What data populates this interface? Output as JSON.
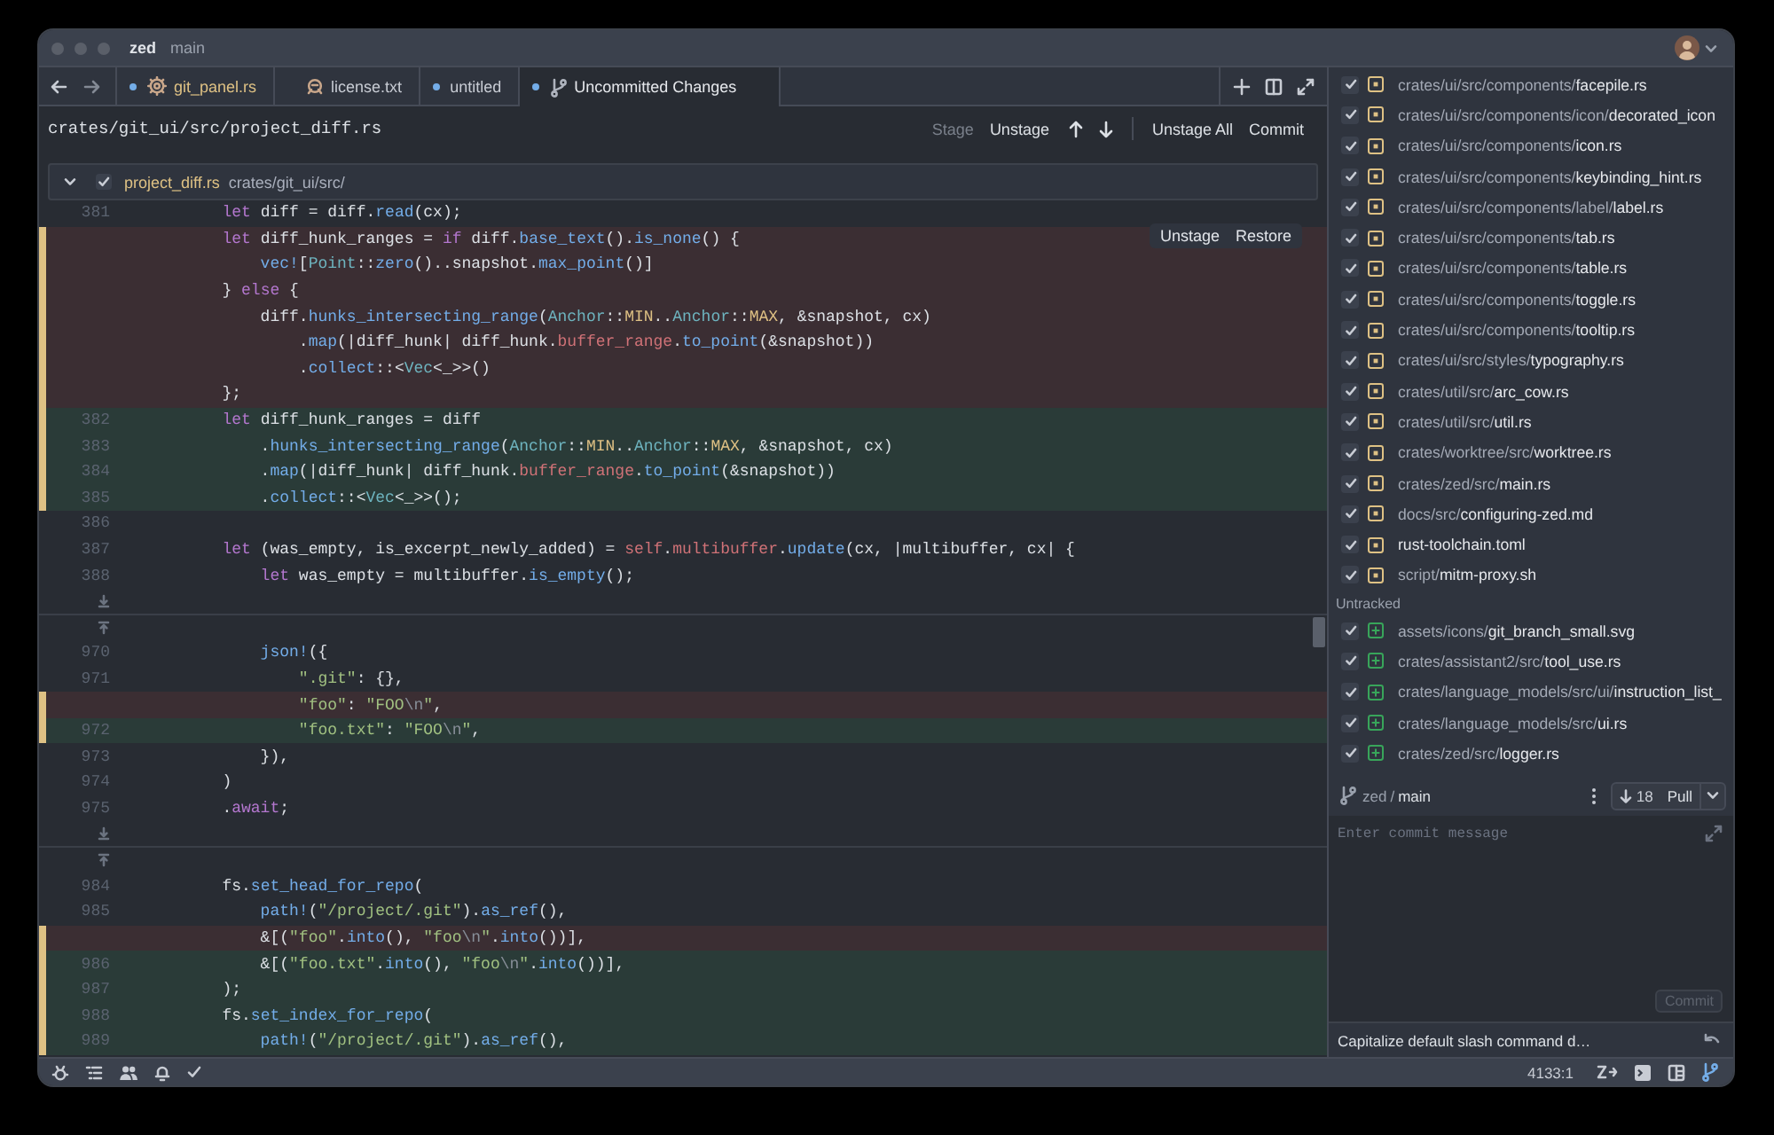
{
  "title_bar": {
    "project": "zed",
    "branch": "main"
  },
  "tabs": [
    {
      "label": "git_panel.rs",
      "selected": false,
      "unsaved": true,
      "git_modified": true,
      "kind": "rust"
    },
    {
      "label": "license.txt",
      "selected": false,
      "unsaved": false,
      "git_modified": false,
      "kind": "license"
    },
    {
      "label": "untitled",
      "selected": false,
      "unsaved": true,
      "git_modified": false,
      "kind": "plain"
    },
    {
      "label": "Uncommitted Changes",
      "selected": true,
      "unsaved": true,
      "git_modified": false,
      "kind": "diff"
    }
  ],
  "toolbar": {
    "path": "crates/git_ui/src/project_diff.rs",
    "stage_buttons": [
      {
        "label": "Stage",
        "disabled": true
      },
      {
        "label": "Unstage",
        "disabled": false
      }
    ],
    "commit_buttons": [
      {
        "label": "Unstage All",
        "disabled": false
      },
      {
        "label": "Commit",
        "disabled": false
      }
    ]
  },
  "excerpt": {
    "expanded": true,
    "checked": true,
    "file": "project_diff.rs",
    "dir": "crates/git_ui/src/"
  },
  "code_rows": [
    {
      "kind": "context",
      "number": "381",
      "code": [
        {
          "kind": "kw",
          "text": "        let"
        },
        {
          "kind": "p",
          "text": " diff = diff."
        },
        {
          "kind": "fn",
          "text": "read"
        },
        {
          "kind": "p",
          "text": "(cx);"
        }
      ]
    },
    {
      "kind": "removed",
      "hunk_controls": [
        "Unstage",
        "Restore"
      ],
      "code": [
        {
          "kind": "kw",
          "text": "        let"
        },
        {
          "kind": "p",
          "text": " diff_hunk_ranges = "
        },
        {
          "kind": "kw",
          "text": "if"
        },
        {
          "kind": "p",
          "text": " diff."
        },
        {
          "kind": "fn",
          "text": "base_text"
        },
        {
          "kind": "p",
          "text": "()."
        },
        {
          "kind": "fn",
          "text": "is_none"
        },
        {
          "kind": "p",
          "text": "() {"
        }
      ]
    },
    {
      "kind": "removed",
      "code": [
        {
          "kind": "fn",
          "text": "            vec!"
        },
        {
          "kind": "p",
          "text": "["
        },
        {
          "kind": "ty",
          "text": "Point"
        },
        {
          "kind": "p",
          "text": "::"
        },
        {
          "kind": "fn",
          "text": "zero"
        },
        {
          "kind": "p",
          "text": "()..snapshot."
        },
        {
          "kind": "fn",
          "text": "max_point"
        },
        {
          "kind": "p",
          "text": "()]"
        }
      ]
    },
    {
      "kind": "removed",
      "code": [
        {
          "kind": "p",
          "text": "        } "
        },
        {
          "kind": "kw",
          "text": "else"
        },
        {
          "kind": "p",
          "text": " {"
        }
      ]
    },
    {
      "kind": "removed",
      "code": [
        {
          "kind": "p",
          "text": "            diff."
        },
        {
          "kind": "fn",
          "text": "hunks_intersecting_range"
        },
        {
          "kind": "p",
          "text": "("
        },
        {
          "kind": "ty",
          "text": "Anchor"
        },
        {
          "kind": "p",
          "text": "::"
        },
        {
          "kind": "const",
          "text": "MIN"
        },
        {
          "kind": "p",
          "text": ".."
        },
        {
          "kind": "ty",
          "text": "Anchor"
        },
        {
          "kind": "p",
          "text": "::"
        },
        {
          "kind": "const",
          "text": "MAX"
        },
        {
          "kind": "p",
          "text": ", &snapshot, cx)"
        }
      ]
    },
    {
      "kind": "removed",
      "code": [
        {
          "kind": "p",
          "text": "                ."
        },
        {
          "kind": "fn",
          "text": "map"
        },
        {
          "kind": "p",
          "text": "(|diff_hunk| diff_hunk."
        },
        {
          "kind": "field",
          "text": "buffer_range"
        },
        {
          "kind": "p",
          "text": "."
        },
        {
          "kind": "fn",
          "text": "to_point"
        },
        {
          "kind": "p",
          "text": "(&snapshot))"
        }
      ]
    },
    {
      "kind": "removed",
      "code": [
        {
          "kind": "p",
          "text": "                ."
        },
        {
          "kind": "fn",
          "text": "collect"
        },
        {
          "kind": "p",
          "text": "::<"
        },
        {
          "kind": "ty",
          "text": "Vec"
        },
        {
          "kind": "p",
          "text": "<_>>()"
        }
      ]
    },
    {
      "kind": "removed",
      "code": [
        {
          "kind": "p",
          "text": "        };"
        }
      ]
    },
    {
      "kind": "added",
      "number": "382",
      "code": [
        {
          "kind": "kw",
          "text": "        let"
        },
        {
          "kind": "p",
          "text": " diff_hunk_ranges = diff"
        }
      ]
    },
    {
      "kind": "added",
      "number": "383",
      "code": [
        {
          "kind": "p",
          "text": "            ."
        },
        {
          "kind": "fn",
          "text": "hunks_intersecting_range"
        },
        {
          "kind": "p",
          "text": "("
        },
        {
          "kind": "ty",
          "text": "Anchor"
        },
        {
          "kind": "p",
          "text": "::"
        },
        {
          "kind": "const",
          "text": "MIN"
        },
        {
          "kind": "p",
          "text": ".."
        },
        {
          "kind": "ty",
          "text": "Anchor"
        },
        {
          "kind": "p",
          "text": "::"
        },
        {
          "kind": "const",
          "text": "MAX"
        },
        {
          "kind": "p",
          "text": ", &snapshot, cx)"
        }
      ]
    },
    {
      "kind": "added",
      "number": "384",
      "code": [
        {
          "kind": "p",
          "text": "            ."
        },
        {
          "kind": "fn",
          "text": "map"
        },
        {
          "kind": "p",
          "text": "(|diff_hunk| diff_hunk."
        },
        {
          "kind": "field",
          "text": "buffer_range"
        },
        {
          "kind": "p",
          "text": "."
        },
        {
          "kind": "fn",
          "text": "to_point"
        },
        {
          "kind": "p",
          "text": "(&snapshot))"
        }
      ]
    },
    {
      "kind": "added",
      "number": "385",
      "code": [
        {
          "kind": "p",
          "text": "            ."
        },
        {
          "kind": "fn",
          "text": "collect"
        },
        {
          "kind": "p",
          "text": "::<"
        },
        {
          "kind": "ty",
          "text": "Vec"
        },
        {
          "kind": "p",
          "text": "<_>>();"
        }
      ]
    },
    {
      "kind": "context",
      "number": "386"
    },
    {
      "kind": "context",
      "number": "387",
      "code": [
        {
          "kind": "kw",
          "text": "        let"
        },
        {
          "kind": "p",
          "text": " (was_empty, is_excerpt_newly_added) = "
        },
        {
          "kind": "field",
          "text": "self"
        },
        {
          "kind": "p",
          "text": "."
        },
        {
          "kind": "field",
          "text": "multibuffer"
        },
        {
          "kind": "p",
          "text": "."
        },
        {
          "kind": "fn",
          "text": "update"
        },
        {
          "kind": "p",
          "text": "(cx, |multibuffer, cx| {"
        }
      ]
    },
    {
      "kind": "context",
      "number": "388",
      "code": [
        {
          "kind": "kw",
          "text": "            let"
        },
        {
          "kind": "p",
          "text": " was_empty = multibuffer."
        },
        {
          "kind": "fn",
          "text": "is_empty"
        },
        {
          "kind": "p",
          "text": "();"
        }
      ]
    },
    {
      "kind": "expand_down"
    },
    {
      "kind": "expand_up"
    },
    {
      "kind": "context",
      "number": "970",
      "code": [
        {
          "kind": "fn",
          "text": "            json!"
        },
        {
          "kind": "p",
          "text": "({"
        }
      ]
    },
    {
      "kind": "context",
      "number": "971",
      "code": [
        {
          "kind": "str",
          "text": "                \".git\""
        },
        {
          "kind": "p",
          "text": ": {},"
        }
      ]
    },
    {
      "kind": "removed",
      "code": [
        {
          "kind": "str",
          "text": "                \"foo\""
        },
        {
          "kind": "p",
          "text": ": "
        },
        {
          "kind": "str",
          "text": "\"FOO"
        },
        {
          "kind": "esc",
          "text": "\\n"
        },
        {
          "kind": "str",
          "text": "\""
        },
        {
          "kind": "p",
          "text": ","
        }
      ]
    },
    {
      "kind": "added",
      "number": "972",
      "code": [
        {
          "kind": "str",
          "text": "                \"foo.txt\""
        },
        {
          "kind": "p",
          "text": ": "
        },
        {
          "kind": "str",
          "text": "\"FOO"
        },
        {
          "kind": "esc",
          "text": "\\n"
        },
        {
          "kind": "str",
          "text": "\""
        },
        {
          "kind": "p",
          "text": ","
        }
      ]
    },
    {
      "kind": "context",
      "number": "973",
      "code": [
        {
          "kind": "p",
          "text": "            }),"
        }
      ]
    },
    {
      "kind": "context",
      "number": "974",
      "code": [
        {
          "kind": "p",
          "text": "        )"
        }
      ]
    },
    {
      "kind": "context",
      "number": "975",
      "code": [
        {
          "kind": "p",
          "text": "        ."
        },
        {
          "kind": "kw",
          "text": "await"
        },
        {
          "kind": "p",
          "text": ";"
        }
      ]
    },
    {
      "kind": "expand_down"
    },
    {
      "kind": "expand_up"
    },
    {
      "kind": "context",
      "number": "984",
      "code": [
        {
          "kind": "p",
          "text": "        fs."
        },
        {
          "kind": "fn",
          "text": "set_head_for_repo"
        },
        {
          "kind": "p",
          "text": "("
        }
      ]
    },
    {
      "kind": "context",
      "number": "985",
      "code": [
        {
          "kind": "fn",
          "text": "            path!"
        },
        {
          "kind": "p",
          "text": "("
        },
        {
          "kind": "str",
          "text": "\"/project/.git\""
        },
        {
          "kind": "p",
          "text": ")."
        },
        {
          "kind": "fn",
          "text": "as_ref"
        },
        {
          "kind": "p",
          "text": "(),"
        }
      ]
    },
    {
      "kind": "removed",
      "code": [
        {
          "kind": "p",
          "text": "            &[("
        },
        {
          "kind": "str",
          "text": "\"foo\""
        },
        {
          "kind": "p",
          "text": "."
        },
        {
          "kind": "fn",
          "text": "into"
        },
        {
          "kind": "p",
          "text": "(), "
        },
        {
          "kind": "str",
          "text": "\"foo"
        },
        {
          "kind": "esc",
          "text": "\\n"
        },
        {
          "kind": "str",
          "text": "\""
        },
        {
          "kind": "p",
          "text": "."
        },
        {
          "kind": "fn",
          "text": "into"
        },
        {
          "kind": "p",
          "text": "())],"
        }
      ]
    },
    {
      "kind": "added",
      "number": "986",
      "code": [
        {
          "kind": "p",
          "text": "            &[("
        },
        {
          "kind": "str",
          "text": "\"foo.txt\""
        },
        {
          "kind": "p",
          "text": "."
        },
        {
          "kind": "fn",
          "text": "into"
        },
        {
          "kind": "p",
          "text": "(), "
        },
        {
          "kind": "str",
          "text": "\"foo"
        },
        {
          "kind": "esc",
          "text": "\\n"
        },
        {
          "kind": "str",
          "text": "\""
        },
        {
          "kind": "p",
          "text": "."
        },
        {
          "kind": "fn",
          "text": "into"
        },
        {
          "kind": "p",
          "text": "())],"
        }
      ]
    },
    {
      "kind": "added",
      "number": "987",
      "code": [
        {
          "kind": "p",
          "text": "        );"
        }
      ]
    },
    {
      "kind": "added",
      "number": "988",
      "code": [
        {
          "kind": "p",
          "text": "        fs."
        },
        {
          "kind": "fn",
          "text": "set_index_for_repo"
        },
        {
          "kind": "p",
          "text": "("
        }
      ]
    },
    {
      "kind": "added",
      "number": "989",
      "code": [
        {
          "kind": "fn",
          "text": "            path!"
        },
        {
          "kind": "p",
          "text": "("
        },
        {
          "kind": "str",
          "text": "\"/project/.git\""
        },
        {
          "kind": "p",
          "text": ")."
        },
        {
          "kind": "fn",
          "text": "as_ref"
        },
        {
          "kind": "p",
          "text": "(),"
        }
      ]
    }
  ],
  "git_panel": {
    "changes": [
      {
        "dir": "crates/ui/src/components/",
        "name": "facepile.rs",
        "checked": true,
        "kind": "modified"
      },
      {
        "dir": "crates/ui/src/components/icon/",
        "name": "decorated_icon",
        "checked": true,
        "kind": "modified"
      },
      {
        "dir": "crates/ui/src/components/",
        "name": "icon.rs",
        "checked": true,
        "kind": "modified"
      },
      {
        "dir": "crates/ui/src/components/",
        "name": "keybinding_hint.rs",
        "checked": true,
        "kind": "modified"
      },
      {
        "dir": "crates/ui/src/components/label/",
        "name": "label.rs",
        "checked": true,
        "kind": "modified"
      },
      {
        "dir": "crates/ui/src/components/",
        "name": "tab.rs",
        "checked": true,
        "kind": "modified"
      },
      {
        "dir": "crates/ui/src/components/",
        "name": "table.rs",
        "checked": true,
        "kind": "modified"
      },
      {
        "dir": "crates/ui/src/components/",
        "name": "toggle.rs",
        "checked": true,
        "kind": "modified"
      },
      {
        "dir": "crates/ui/src/components/",
        "name": "tooltip.rs",
        "checked": true,
        "kind": "modified"
      },
      {
        "dir": "crates/ui/src/styles/",
        "name": "typography.rs",
        "checked": true,
        "kind": "modified"
      },
      {
        "dir": "crates/util/src/",
        "name": "arc_cow.rs",
        "checked": true,
        "kind": "modified"
      },
      {
        "dir": "crates/util/src/",
        "name": "util.rs",
        "checked": true,
        "kind": "modified"
      },
      {
        "dir": "crates/worktree/src/",
        "name": "worktree.rs",
        "checked": true,
        "kind": "modified"
      },
      {
        "dir": "crates/zed/src/",
        "name": "main.rs",
        "checked": true,
        "kind": "modified"
      },
      {
        "dir": "docs/src/",
        "name": "configuring-zed.md",
        "checked": true,
        "kind": "modified"
      },
      {
        "name": "rust-toolchain.toml",
        "checked": true,
        "kind": "modified"
      },
      {
        "dir": "script/",
        "name": "mitm-proxy.sh",
        "checked": true,
        "kind": "modified"
      }
    ],
    "untracked_header": "Untracked",
    "untracked": [
      {
        "dir": "assets/icons/",
        "name": "git_branch_small.svg",
        "checked": true,
        "kind": "added"
      },
      {
        "dir": "crates/assistant2/src/",
        "name": "tool_use.rs",
        "checked": true,
        "kind": "added"
      },
      {
        "dir": "crates/language_models/src/ui/",
        "name": "instruction_list_",
        "checked": true,
        "kind": "added"
      },
      {
        "dir": "crates/language_models/src/",
        "name": "ui.rs",
        "checked": true,
        "kind": "added"
      },
      {
        "dir": "crates/zed/src/",
        "name": "logger.rs",
        "checked": true,
        "kind": "added"
      }
    ],
    "branch_bar": {
      "repo": "zed",
      "separator": "/",
      "branch": "main",
      "behind": "18",
      "action": "Pull"
    },
    "commit": {
      "placeholder": "Enter commit message",
      "button": {
        "label": "Commit",
        "disabled": true
      }
    },
    "last_commit": "Capitalize default slash command d…"
  },
  "status_bar": {
    "position": "4133:1",
    "left_tools": [
      {
        "kind": "debug",
        "active": false
      },
      {
        "kind": "outline",
        "active": false
      },
      {
        "kind": "people",
        "active": false
      },
      {
        "kind": "bell",
        "active": false
      },
      {
        "kind": "check",
        "active": false
      }
    ],
    "right_tools": [
      {
        "kind": "predict",
        "active": false
      },
      {
        "kind": "terminal",
        "active": false
      },
      {
        "kind": "panel",
        "active": false
      },
      {
        "kind": "branch",
        "active": true
      }
    ]
  }
}
